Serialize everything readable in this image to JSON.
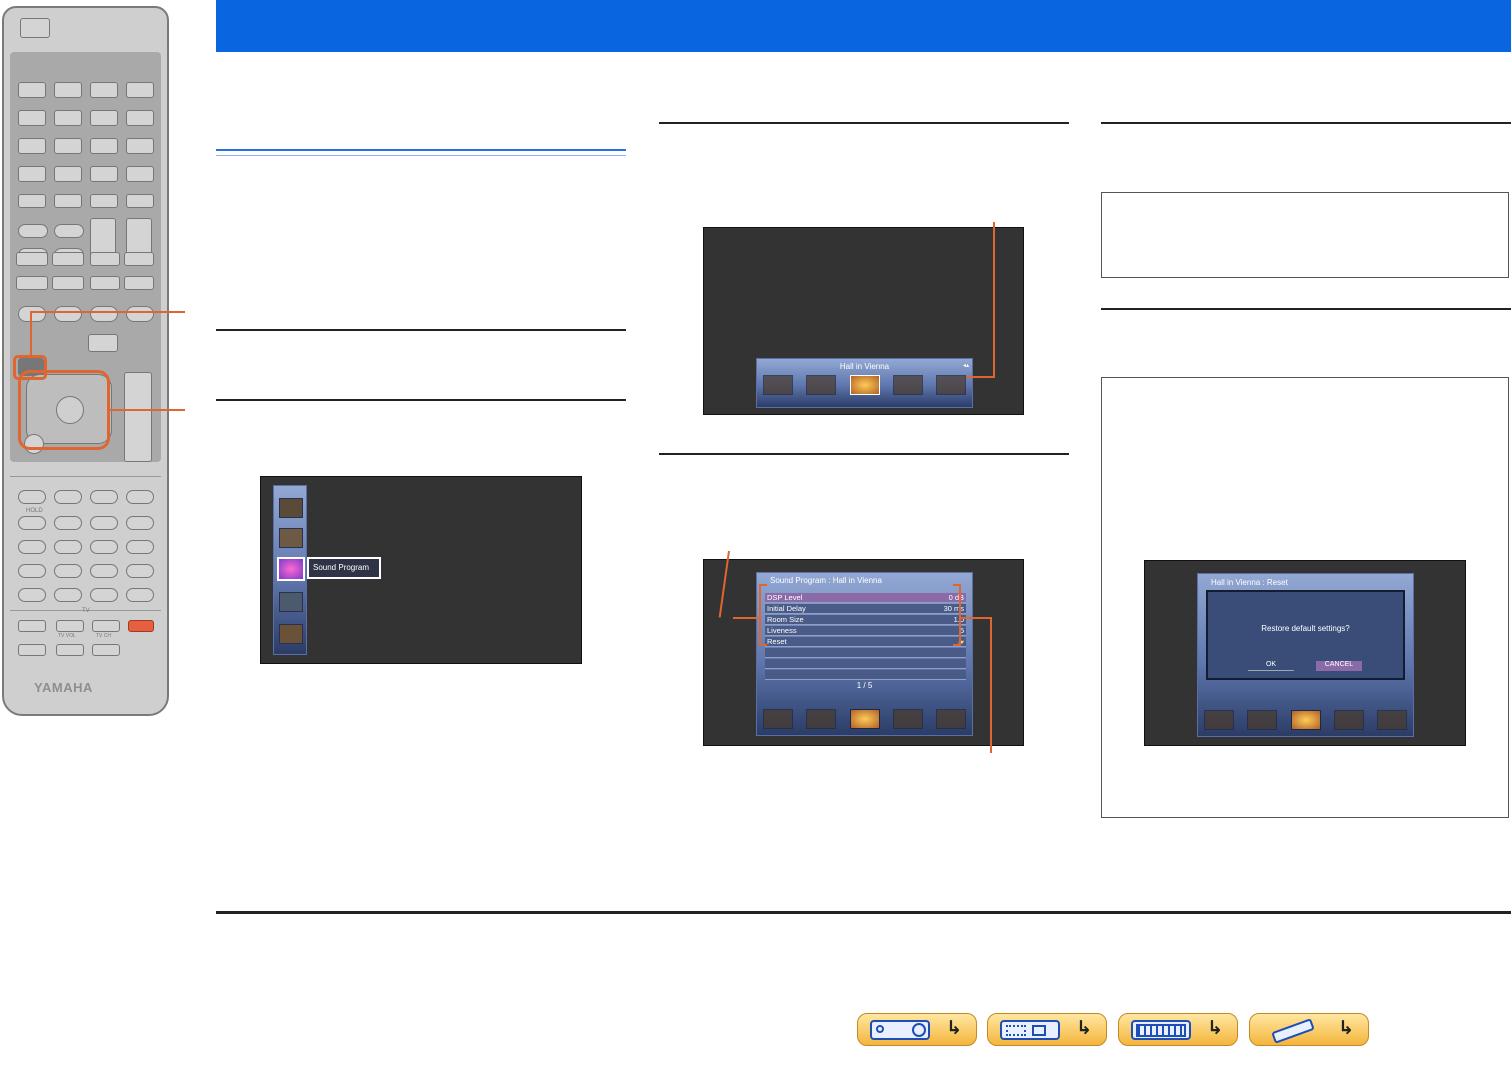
{
  "brand": "YAMAHA",
  "remote": {
    "tv_label": "TV",
    "tv_vol_label": "TV VOL",
    "tv_ch_label": "TV CH",
    "hold_label": "HOLD"
  },
  "screen1": {
    "menu_item_label": "Sound Program"
  },
  "screen2": {
    "program_name": "Hall in Vienna"
  },
  "screen3": {
    "title": "Sound Program : Hall in Vienna",
    "params": [
      {
        "name": "DSP Level",
        "value": "0 dB"
      },
      {
        "name": "Initial Delay",
        "value": "30 ms"
      },
      {
        "name": "Room Size",
        "value": "1.0"
      },
      {
        "name": "Liveness",
        "value": "5"
      },
      {
        "name": "Reset",
        "value": ""
      }
    ],
    "page_indicator": "1 / 5"
  },
  "screen4": {
    "title": "Hall in Vienna : Reset",
    "question": "Restore default settings?",
    "ok_label": "OK",
    "cancel_label": "CANCEL"
  },
  "colors": {
    "header_blue": "#0a66e0",
    "callout_orange": "#e0662f",
    "nav_button_yellow": "#f4b53c"
  },
  "nav_buttons": [
    {
      "icon": "receiver-front-panel-icon"
    },
    {
      "icon": "receiver-rear-panel-icon"
    },
    {
      "icon": "front-display-icon"
    },
    {
      "icon": "remote-control-icon"
    }
  ]
}
